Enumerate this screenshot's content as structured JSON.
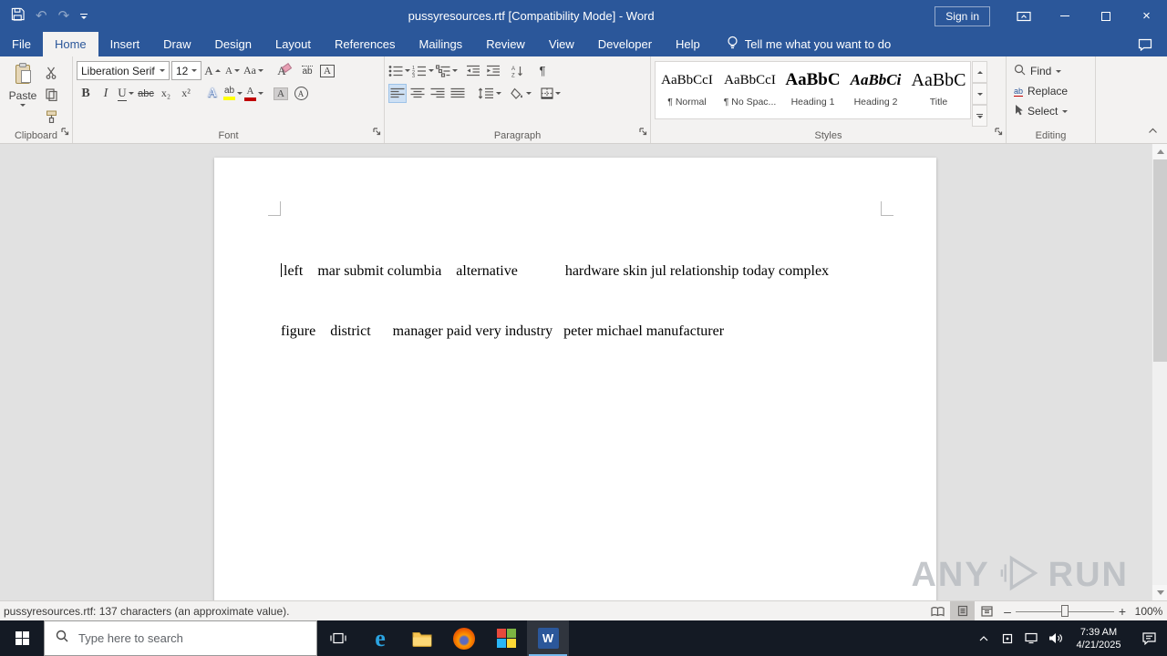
{
  "titlebar": {
    "title": "pussyresources.rtf [Compatibility Mode]  -  Word",
    "sign_in": "Sign in"
  },
  "menu": {
    "file": "File",
    "tabs": [
      "Home",
      "Insert",
      "Draw",
      "Design",
      "Layout",
      "References",
      "Mailings",
      "Review",
      "View",
      "Developer",
      "Help"
    ],
    "active_tab": "Home",
    "tell_me": "Tell me what you want to do"
  },
  "icons": {
    "undo": "↶",
    "redo": "↷",
    "close": "×",
    "edge": "e",
    "bold": "B",
    "italic": "I",
    "underline": "U",
    "strikethrough": "abc",
    "subscript": "x₂",
    "superscript": "x²",
    "text_effects": "A",
    "highlight": "ab",
    "font_color": "A",
    "char_shading": "A",
    "char_border": "A",
    "enclose": "A",
    "phonetic": "ab",
    "grow_font": "A",
    "shrink_font": "A",
    "change_case": "Aa",
    "clear_format": "A",
    "pilcrow": "¶",
    "replace": "ab",
    "zoom_out": "–",
    "zoom_in": "+"
  },
  "ribbon": {
    "clipboard": {
      "group": "Clipboard",
      "paste": "Paste"
    },
    "font": {
      "group": "Font",
      "family": "Liberation Serif",
      "size": "12"
    },
    "paragraph": {
      "group": "Paragraph"
    },
    "styles": {
      "group": "Styles",
      "items": [
        {
          "preview": "AaBbCcI",
          "name": "¶ Normal"
        },
        {
          "preview": "AaBbCcI",
          "name": "¶ No Spac..."
        },
        {
          "preview": "AaBbC",
          "name": "Heading 1"
        },
        {
          "preview": "AaBbCi",
          "name": "Heading 2"
        },
        {
          "preview": "AaBbC",
          "name": "Title"
        }
      ]
    },
    "editing": {
      "group": "Editing",
      "find": "Find",
      "replace": "Replace",
      "select": "Select"
    }
  },
  "document": {
    "line1": "left    mar submit columbia    alternative             hardware skin jul relationship today complex",
    "line2": "figure    district      manager paid very industry   peter michael manufacturer"
  },
  "statusbar": {
    "info": "pussyresources.rtf: 137 characters (an approximate value).",
    "zoom": "100%"
  },
  "taskbar": {
    "search_placeholder": "Type here to search",
    "time": "7:39 AM",
    "date": "4/21/2025"
  },
  "watermark": {
    "left": "ANY",
    "right": "RUN"
  }
}
